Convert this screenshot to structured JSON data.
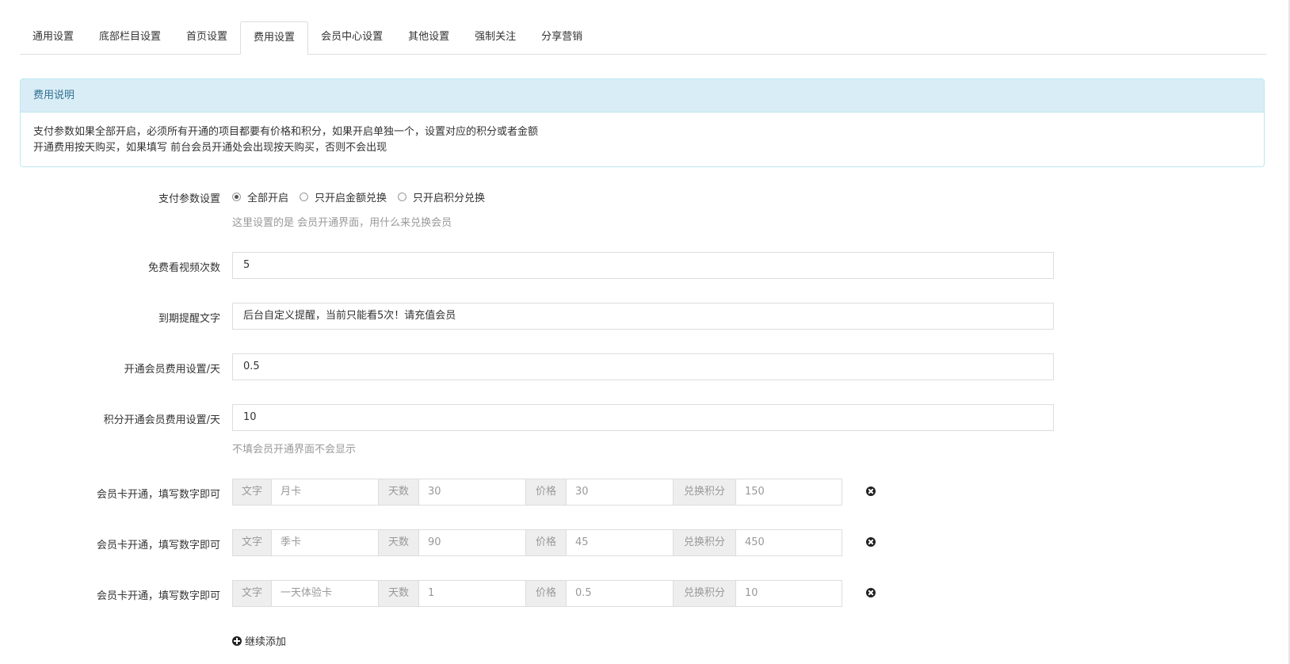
{
  "tabs": [
    {
      "label": "通用设置"
    },
    {
      "label": "底部栏目设置"
    },
    {
      "label": "首页设置"
    },
    {
      "label": "费用设置"
    },
    {
      "label": "会员中心设置"
    },
    {
      "label": "其他设置"
    },
    {
      "label": "强制关注"
    },
    {
      "label": "分享营销"
    }
  ],
  "active_tab": "费用设置",
  "panel": {
    "title": "费用说明",
    "line1": "支付参数如果全部开启，必须所有开通的项目都要有价格和积分，如果开启单独一个，设置对应的积分或者金额",
    "line2": "开通费用按天购买，如果填写 前台会员开通处会出现按天购买，否则不会出现"
  },
  "payment": {
    "label": "支付参数设置",
    "options": [
      "全部开启",
      "只开启金额兑换",
      "只开启积分兑换"
    ],
    "selected": "全部开启",
    "help": "这里设置的是 会员开通界面，用什么来兑换会员"
  },
  "fields": {
    "free_views": {
      "label": "免费看视频次数",
      "value": "5"
    },
    "expire_text": {
      "label": "到期提醒文字",
      "value": "后台自定义提醒，当前只能看5次！请充值会员"
    },
    "daily_fee": {
      "label": "开通会员费用设置/天",
      "value": "0.5"
    },
    "daily_points": {
      "label": "积分开通会员费用设置/天",
      "value": "10",
      "help": "不填会员开通界面不会显示"
    }
  },
  "cards": {
    "row_label": "会员卡开通，填写数字即可",
    "addon_text": "文字",
    "addon_days": "天数",
    "addon_price": "价格",
    "addon_points": "兑换积分",
    "items": [
      {
        "text": "月卡",
        "days": "30",
        "price": "30",
        "points": "150"
      },
      {
        "text": "季卡",
        "days": "90",
        "price": "45",
        "points": "450"
      },
      {
        "text": "一天体验卡",
        "days": "1",
        "price": "0.5",
        "points": "10"
      }
    ]
  },
  "add_more": "继续添加"
}
